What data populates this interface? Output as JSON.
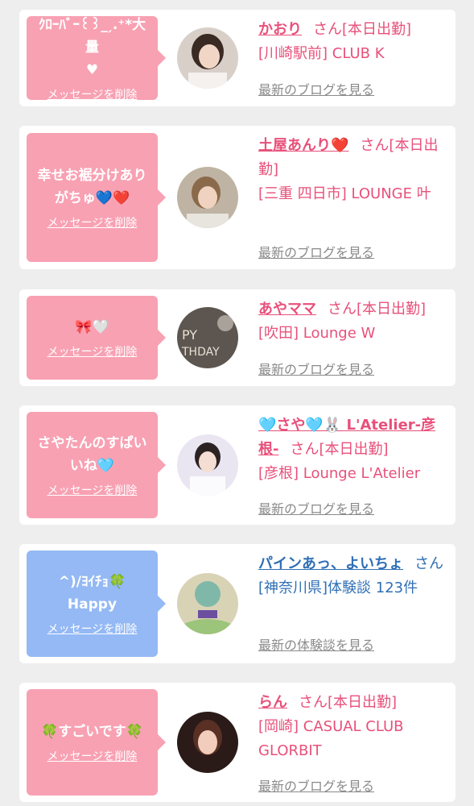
{
  "colors": {
    "pink": "#f8a1b3",
    "blue": "#94b9f4",
    "name_pink": "#e8507a",
    "name_blue": "#2f6fb5",
    "page_bg": "#eeeeee"
  },
  "items": [
    {
      "message": "ｸﾛｰﾊﾞｰ꒰꒱_ ̗.⁺*大量\n♥",
      "delete_label": "メッセージを削除",
      "name": "かおり",
      "suffix": "さん[本日出勤]",
      "shop": "[川崎駅前] CLUB K",
      "link": "最新のブログを見る"
    },
    {
      "message": "幸せお裾分けあり\nがちゅ💙❤️",
      "delete_label": "メッセージを削除",
      "name": "土屋あんり❤️",
      "suffix": "さん[本日出勤]",
      "shop": "[三重 四日市] LOUNGE 叶",
      "link": "最新のブログを見る"
    },
    {
      "message": "🎀🤍",
      "delete_label": "メッセージを削除",
      "name": "あやママ",
      "suffix": "さん[本日出勤]",
      "shop": "[吹田] Lounge W",
      "link": "最新のブログを見る"
    },
    {
      "message": "さやたんのすぱい\nいね🩵",
      "delete_label": "メッセージを削除",
      "name": "🩵さや🩵🐰 L'Atelier-彦根-",
      "suffix": "さん[本日出勤]",
      "shop": "[彦根] Lounge L'Atelier",
      "link": "最新のブログを見る"
    },
    {
      "message": "^)/ﾖｲﾁｮ🍀\nHappy",
      "delete_label": "メッセージを削除",
      "name": "パインあっ、よいちょ",
      "suffix": "さん",
      "shop": "[神奈川県]体験談 123件",
      "link": "最新の体験談を見る"
    },
    {
      "message": "🍀すごいです🍀",
      "delete_label": "メッセージを削除",
      "name": "らん",
      "suffix": "さん[本日出勤]",
      "shop": "[岡崎] CASUAL CLUB GLORBIT",
      "link": "最新のブログを見る"
    }
  ]
}
